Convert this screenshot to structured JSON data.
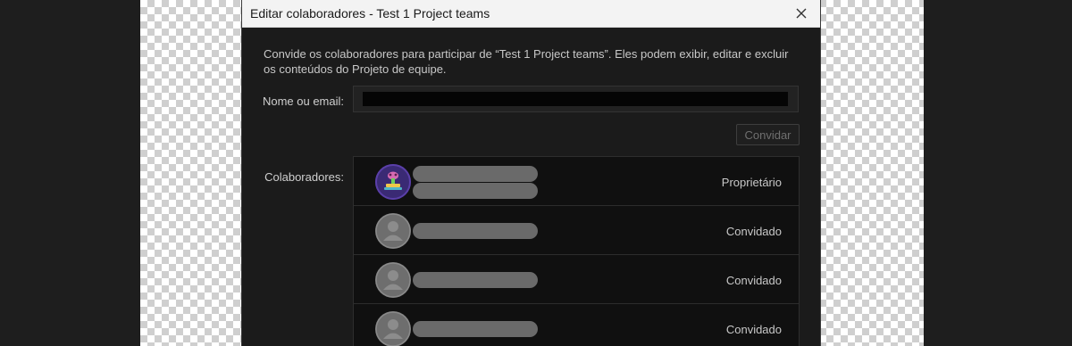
{
  "dialog": {
    "title": "Editar colaboradores - Test 1 Project teams",
    "description": "Convide os colaboradores para participar de “Test 1 Project teams”. Eles podem exibir, editar e excluir os conteúdos do Projeto de equipe.",
    "name_label": "Nome ou email:",
    "name_value": "",
    "invite_label": "Convidar",
    "collaborators_label": "Colaboradores:",
    "collaborators": [
      {
        "role": "Proprietário",
        "avatar": "owner-avatar"
      },
      {
        "role": "Convidado",
        "avatar": "default-user-avatar"
      },
      {
        "role": "Convidado",
        "avatar": "default-user-avatar"
      },
      {
        "role": "Convidado",
        "avatar": "default-user-avatar"
      }
    ]
  },
  "colors": {
    "dialog_bg": "#1b1b1b",
    "titlebar_bg": "#f3f3f3",
    "list_bg": "#101010"
  }
}
